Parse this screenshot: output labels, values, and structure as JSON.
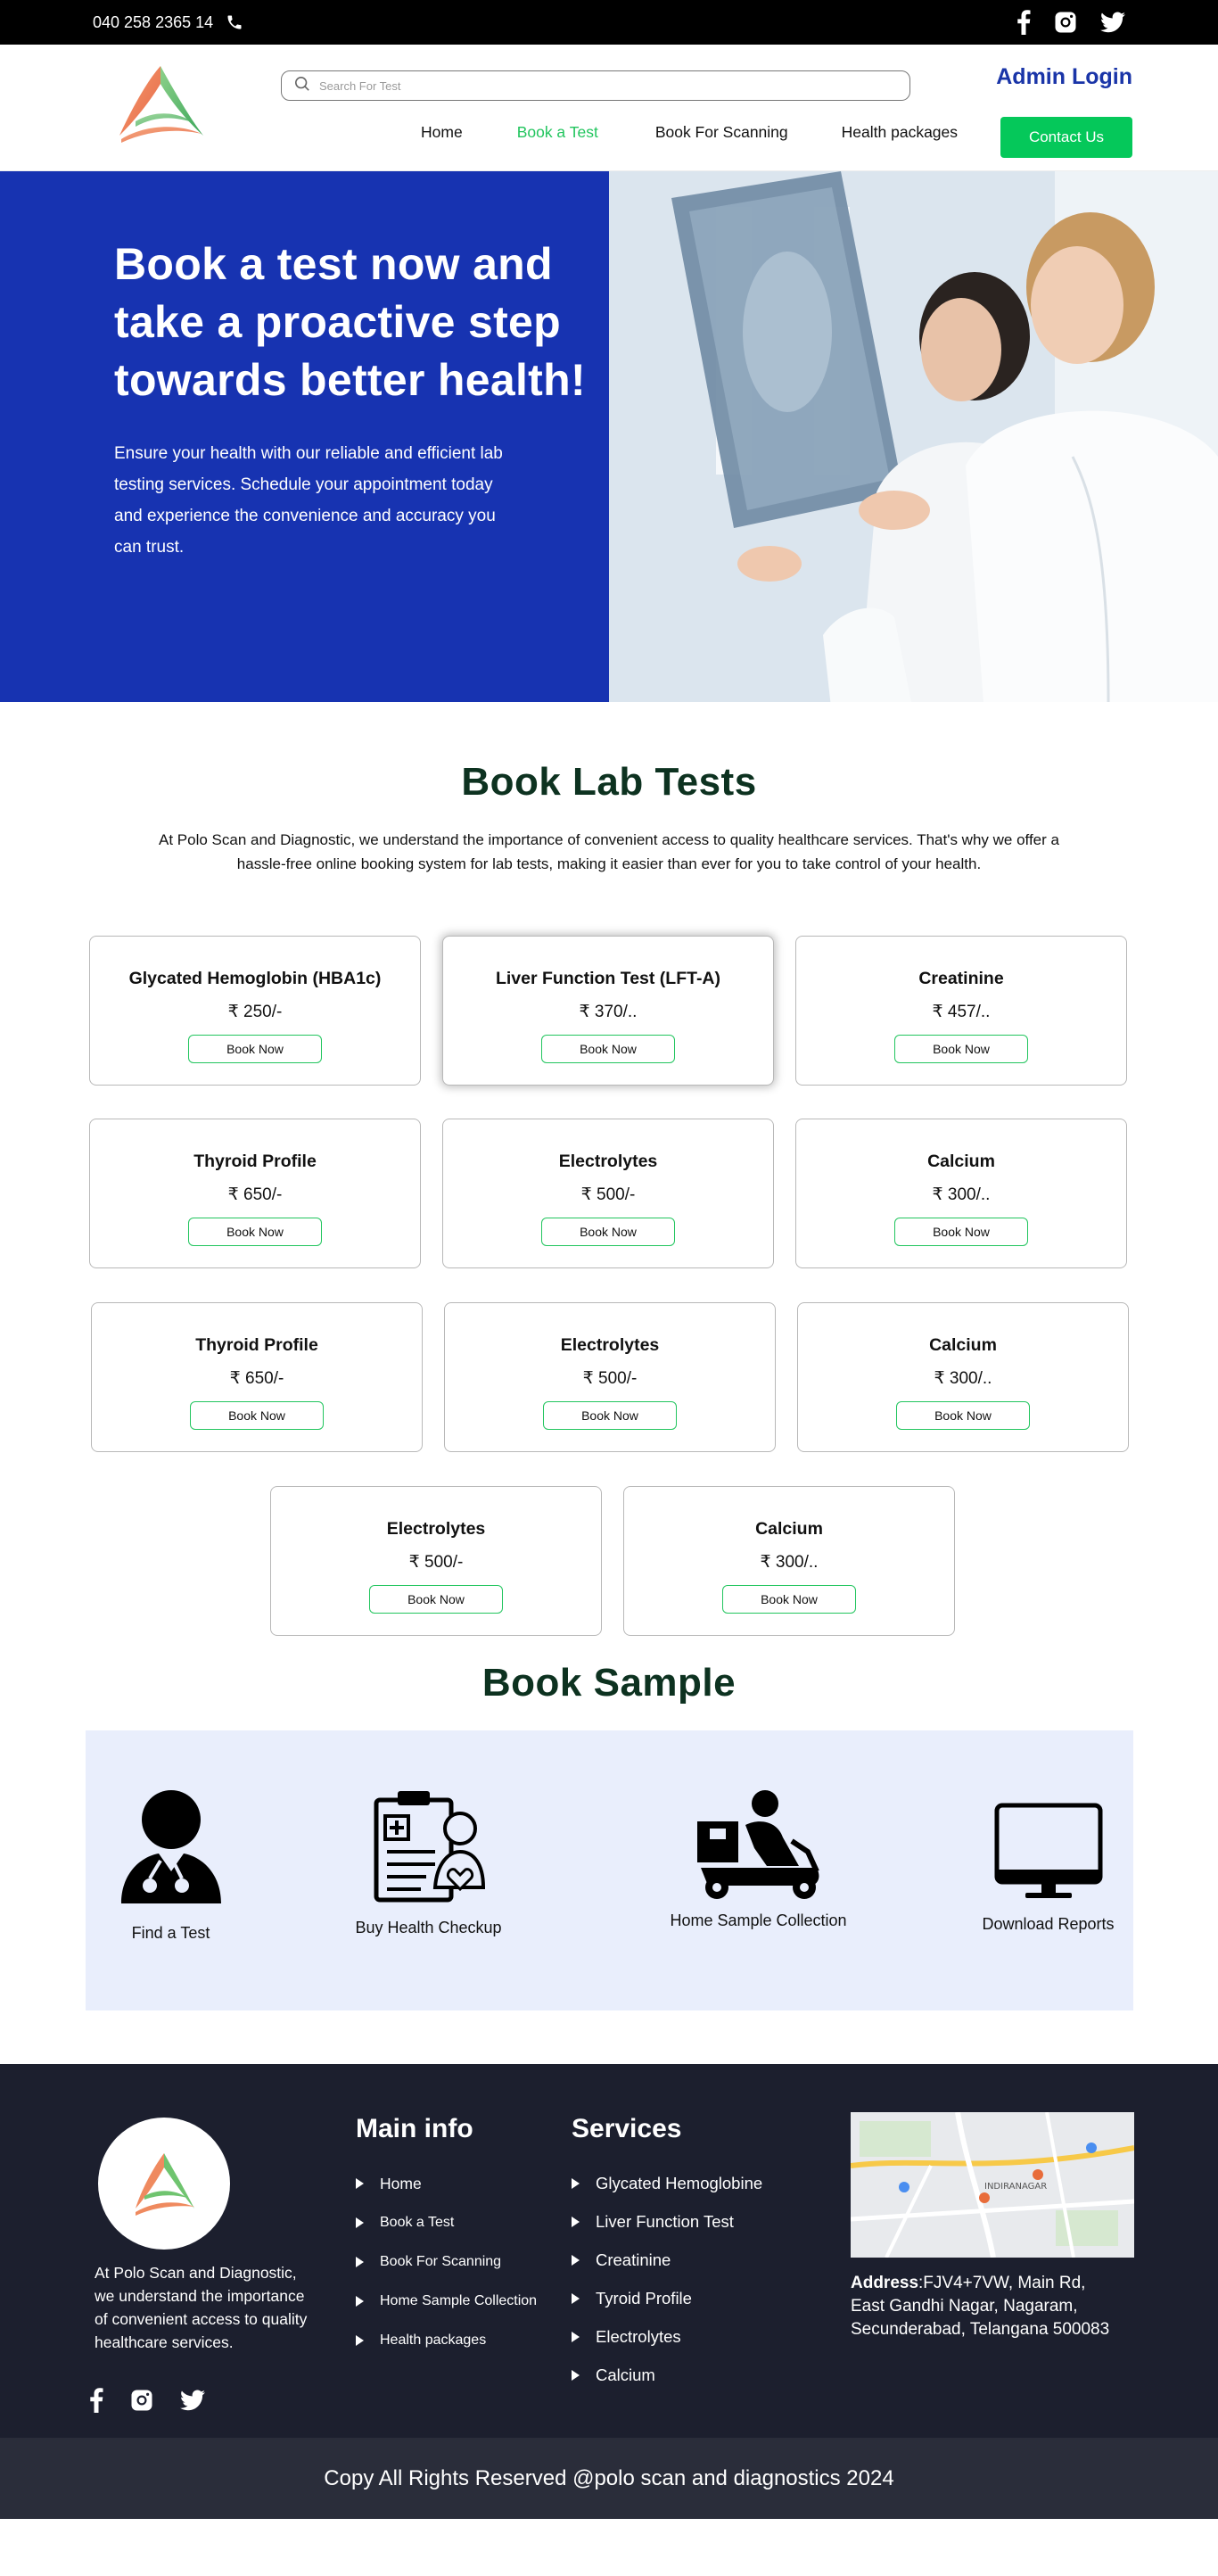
{
  "topbar": {
    "phone": "040 258 2365 14",
    "social": [
      "facebook-icon",
      "instagram-icon",
      "twitter-icon"
    ]
  },
  "header": {
    "search_placeholder": "Search For Test",
    "admin_login": "Admin Login",
    "nav": [
      {
        "label": "Home",
        "active": false
      },
      {
        "label": "Book a Test",
        "active": true
      },
      {
        "label": "Book For Scanning",
        "active": false
      },
      {
        "label": "Health packages",
        "active": false
      }
    ],
    "contact_button": "Contact Us"
  },
  "hero": {
    "heading": "Book a test now and take a proactive step towards better health!",
    "text": "Ensure your health with our reliable and efficient lab testing services. Schedule your appointment today and experience the convenience and accuracy you can trust."
  },
  "lab_tests": {
    "title": "Book Lab Tests",
    "description": "At Polo Scan and Diagnostic, we understand the importance of convenient access to quality healthcare services. That's why we offer a hassle-free online booking system for lab tests, making it easier than ever for you to take control of your health.",
    "book_label": "Book Now",
    "cards": [
      {
        "name": "Glycated Hemoglobin (HBA1c)",
        "price": "₹ 250/-"
      },
      {
        "name": "Liver Function Test (LFT-A)",
        "price": "₹ 370/.."
      },
      {
        "name": "Creatinine",
        "price": "₹ 457/.."
      },
      {
        "name": "Thyroid Profile",
        "price": "₹ 650/-"
      },
      {
        "name": "Electrolytes",
        "price": "₹ 500/-"
      },
      {
        "name": "Calcium",
        "price": "₹ 300/.."
      },
      {
        "name": "Thyroid Profile",
        "price": "₹ 650/-"
      },
      {
        "name": "Electrolytes",
        "price": "₹ 500/-"
      },
      {
        "name": "Calcium",
        "price": "₹ 300/.."
      },
      {
        "name": "Electrolytes",
        "price": "₹ 500/-"
      },
      {
        "name": "Calcium",
        "price": "₹ 300/.."
      }
    ]
  },
  "sample": {
    "title": "Book Sample",
    "items": [
      {
        "label": "Find a Test",
        "icon": "doctor-icon"
      },
      {
        "label": "Buy Health Checkup",
        "icon": "health-checkup-icon"
      },
      {
        "label": "Home Sample Collection",
        "icon": "delivery-scooter-icon"
      },
      {
        "label": "Download Reports",
        "icon": "monitor-icon"
      }
    ]
  },
  "footer": {
    "about": "At Polo Scan and Diagnostic, we understand the importance of convenient access to quality healthcare services.",
    "main_info_title": "Main info",
    "main_info": [
      "Home",
      "Book a Test",
      "Book For Scanning",
      "Home Sample Collection",
      "Health packages"
    ],
    "services_title": "Services",
    "services": [
      "Glycated Hemoglobine",
      "Liver Function Test",
      "Creatinine",
      "Tyroid Profile",
      "Electrolytes",
      "Calcium"
    ],
    "address_label": "Address",
    "address": ":FJV4+7VW, Main Rd, East Gandhi Nagar, Nagaram, Secunderabad, Telangana 500083",
    "map_label": "INDIRANAGAR",
    "copyright": "Copy All Rights Reserved @polo scan and diagnostics  2024"
  },
  "colors": {
    "brand_blue": "#1733b1",
    "accent_green": "#05c85a",
    "title_green": "#0d3220",
    "footer_bg": "#1c1f2e"
  }
}
